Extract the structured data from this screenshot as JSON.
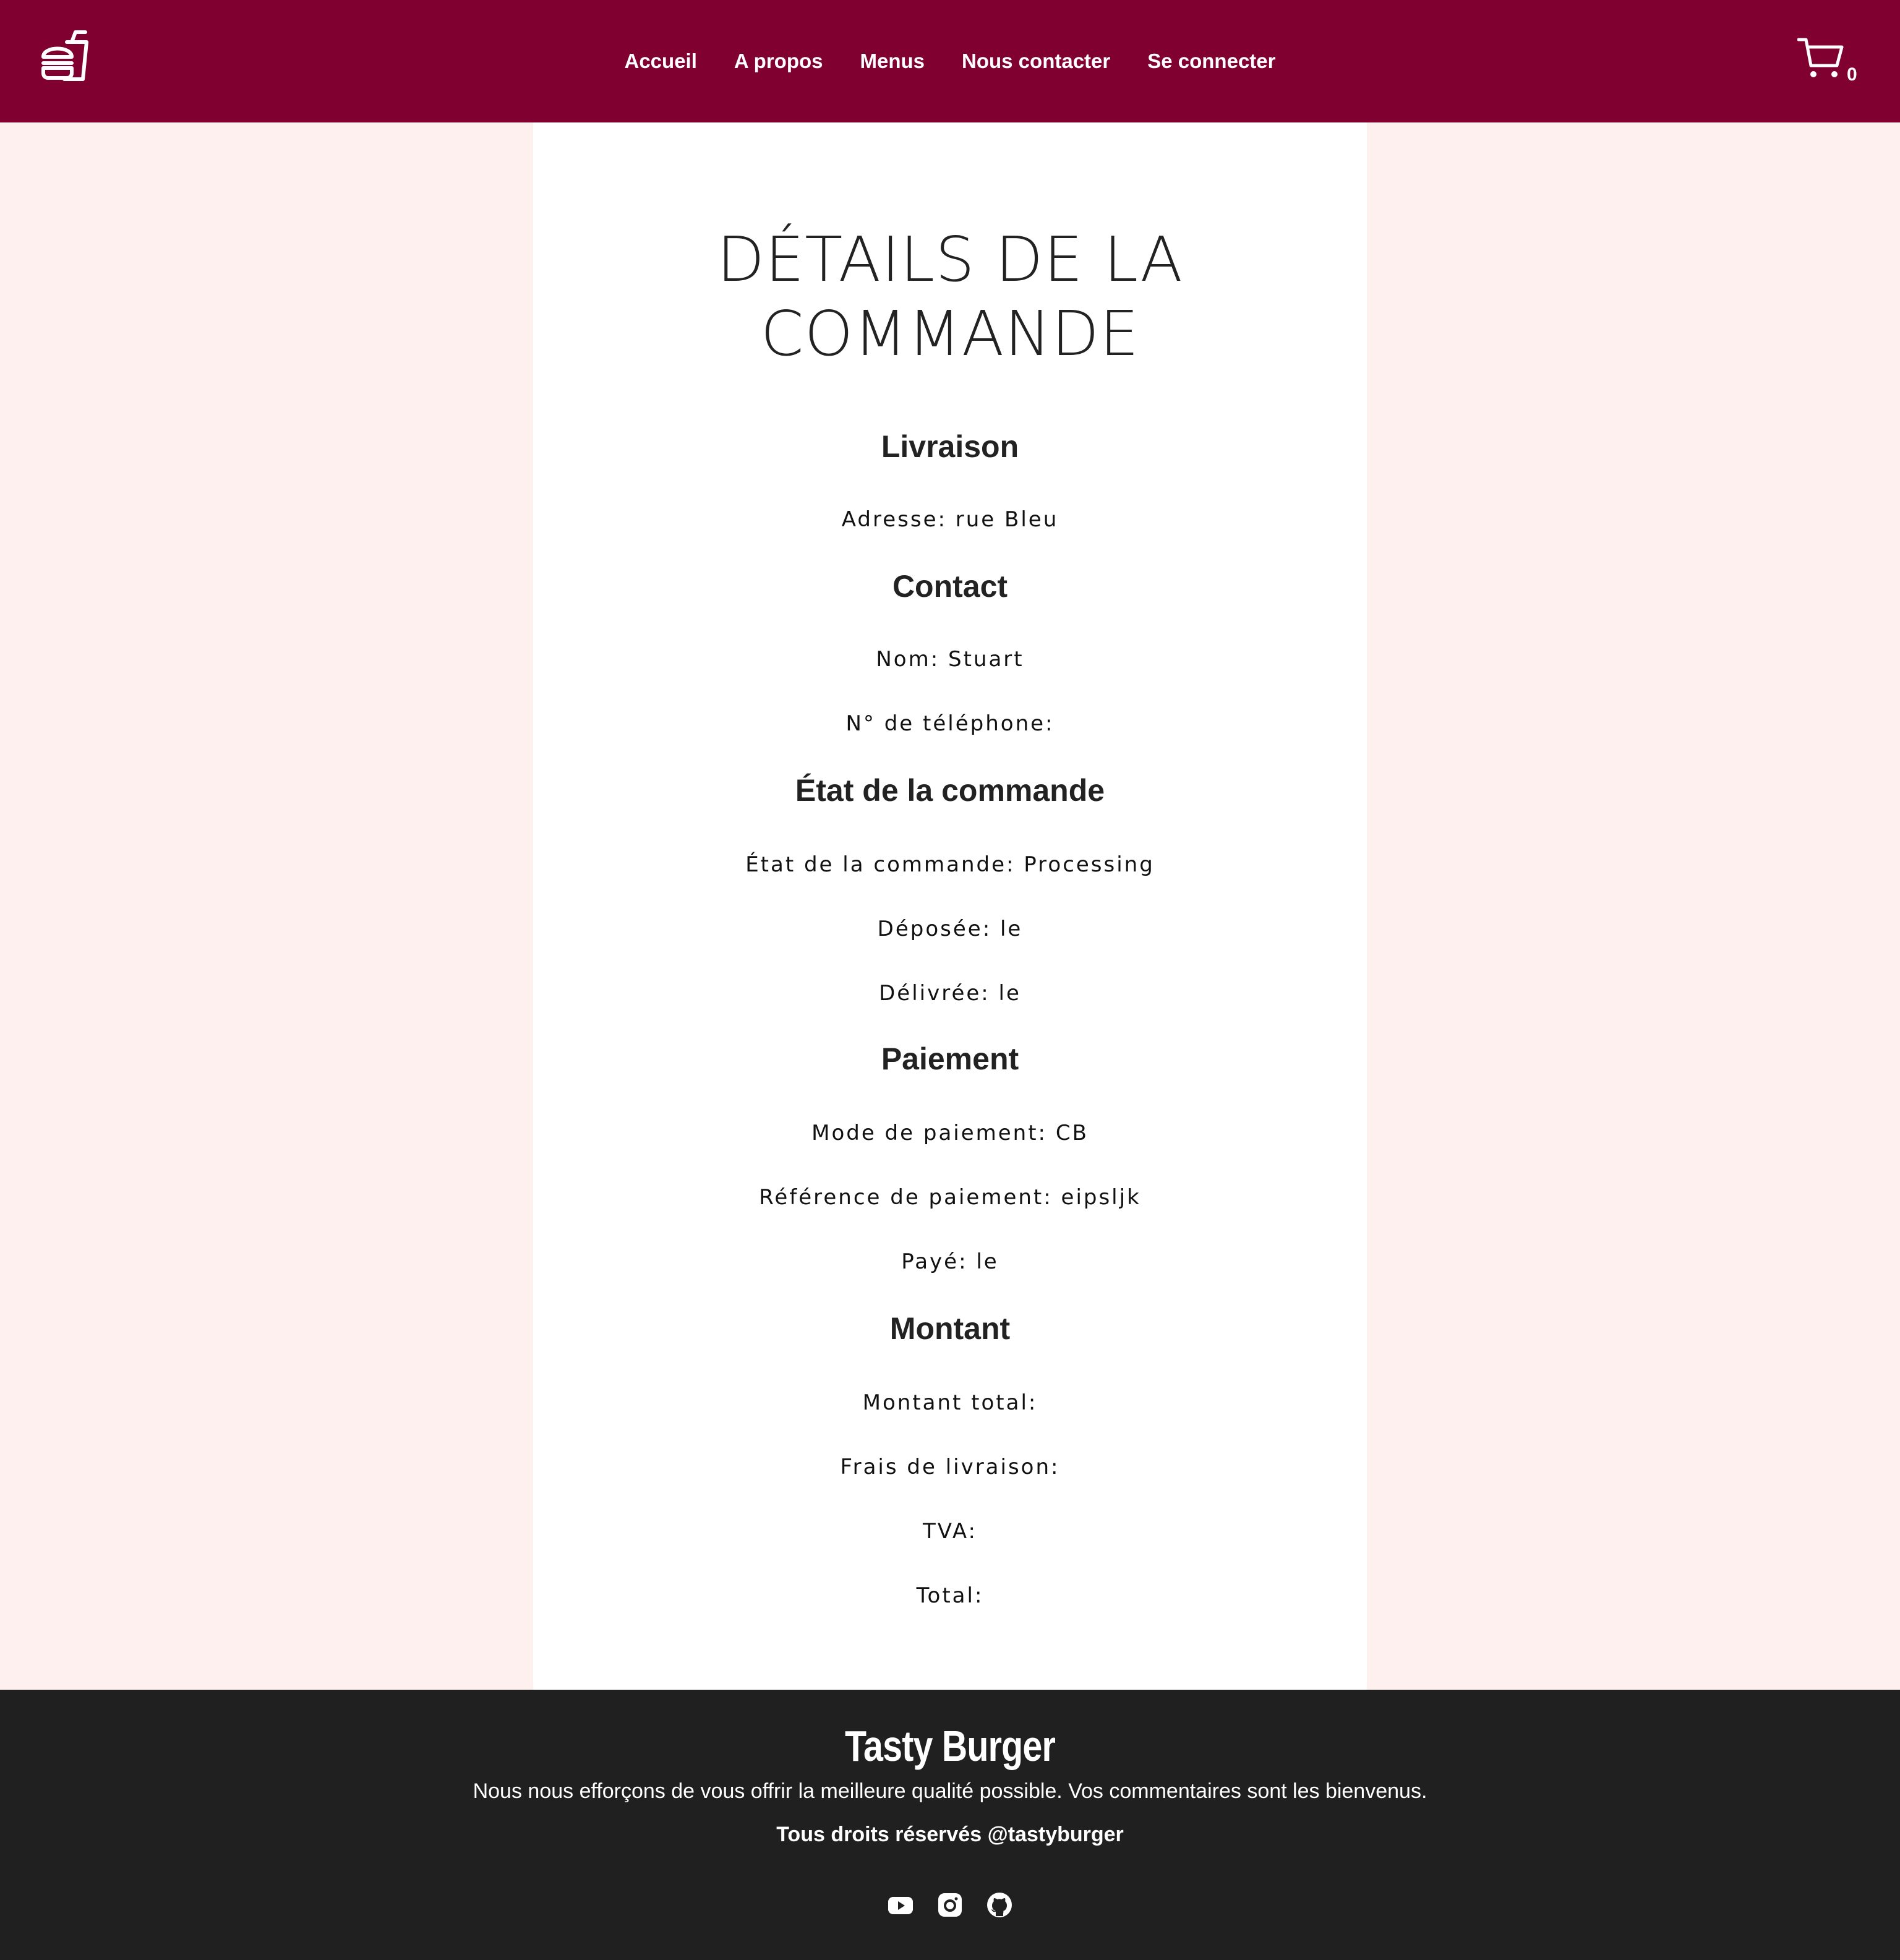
{
  "header": {
    "logo_icon": "burger-drink-icon",
    "nav": [
      {
        "label": "Accueil"
      },
      {
        "label": "A propos"
      },
      {
        "label": "Menus"
      },
      {
        "label": "Nous contacter"
      },
      {
        "label": "Se connecter"
      }
    ],
    "cart_icon": "shopping-cart-icon",
    "cart_count": "0",
    "background_color": "#800030"
  },
  "main": {
    "title_line1": "DÉTAILS DE LA",
    "title_line2": "COMMANDE",
    "livraison": {
      "heading": "Livraison",
      "address": "Adresse: rue Bleu"
    },
    "contact": {
      "heading": "Contact",
      "name": "Nom: Stuart",
      "phone": "N° de téléphone:"
    },
    "status": {
      "heading": "État de la commande",
      "state": "État de la commande: Processing",
      "placed": "Déposée: le",
      "delivered": "Délivrée: le"
    },
    "payment": {
      "heading": "Paiement",
      "method": "Mode de paiement: CB",
      "reference": "Référence de paiement: eipsljk",
      "paid": "Payé: le"
    },
    "amount": {
      "heading": "Montant",
      "subtotal": "Montant total:",
      "shipping": "Frais de livraison:",
      "tax": "TVA:",
      "total": "Total:"
    },
    "page_background": "#fff0f0"
  },
  "footer": {
    "brand": "Tasty Burger",
    "tagline": "Nous nous efforçons de vous offrir la meilleure qualité possible. Vos commentaires sont les bienvenus.",
    "rights": "Tous droits réservés @tastyburger",
    "social_icons": [
      "youtube-icon",
      "instagram-icon",
      "github-icon"
    ],
    "background_color": "#202020"
  }
}
